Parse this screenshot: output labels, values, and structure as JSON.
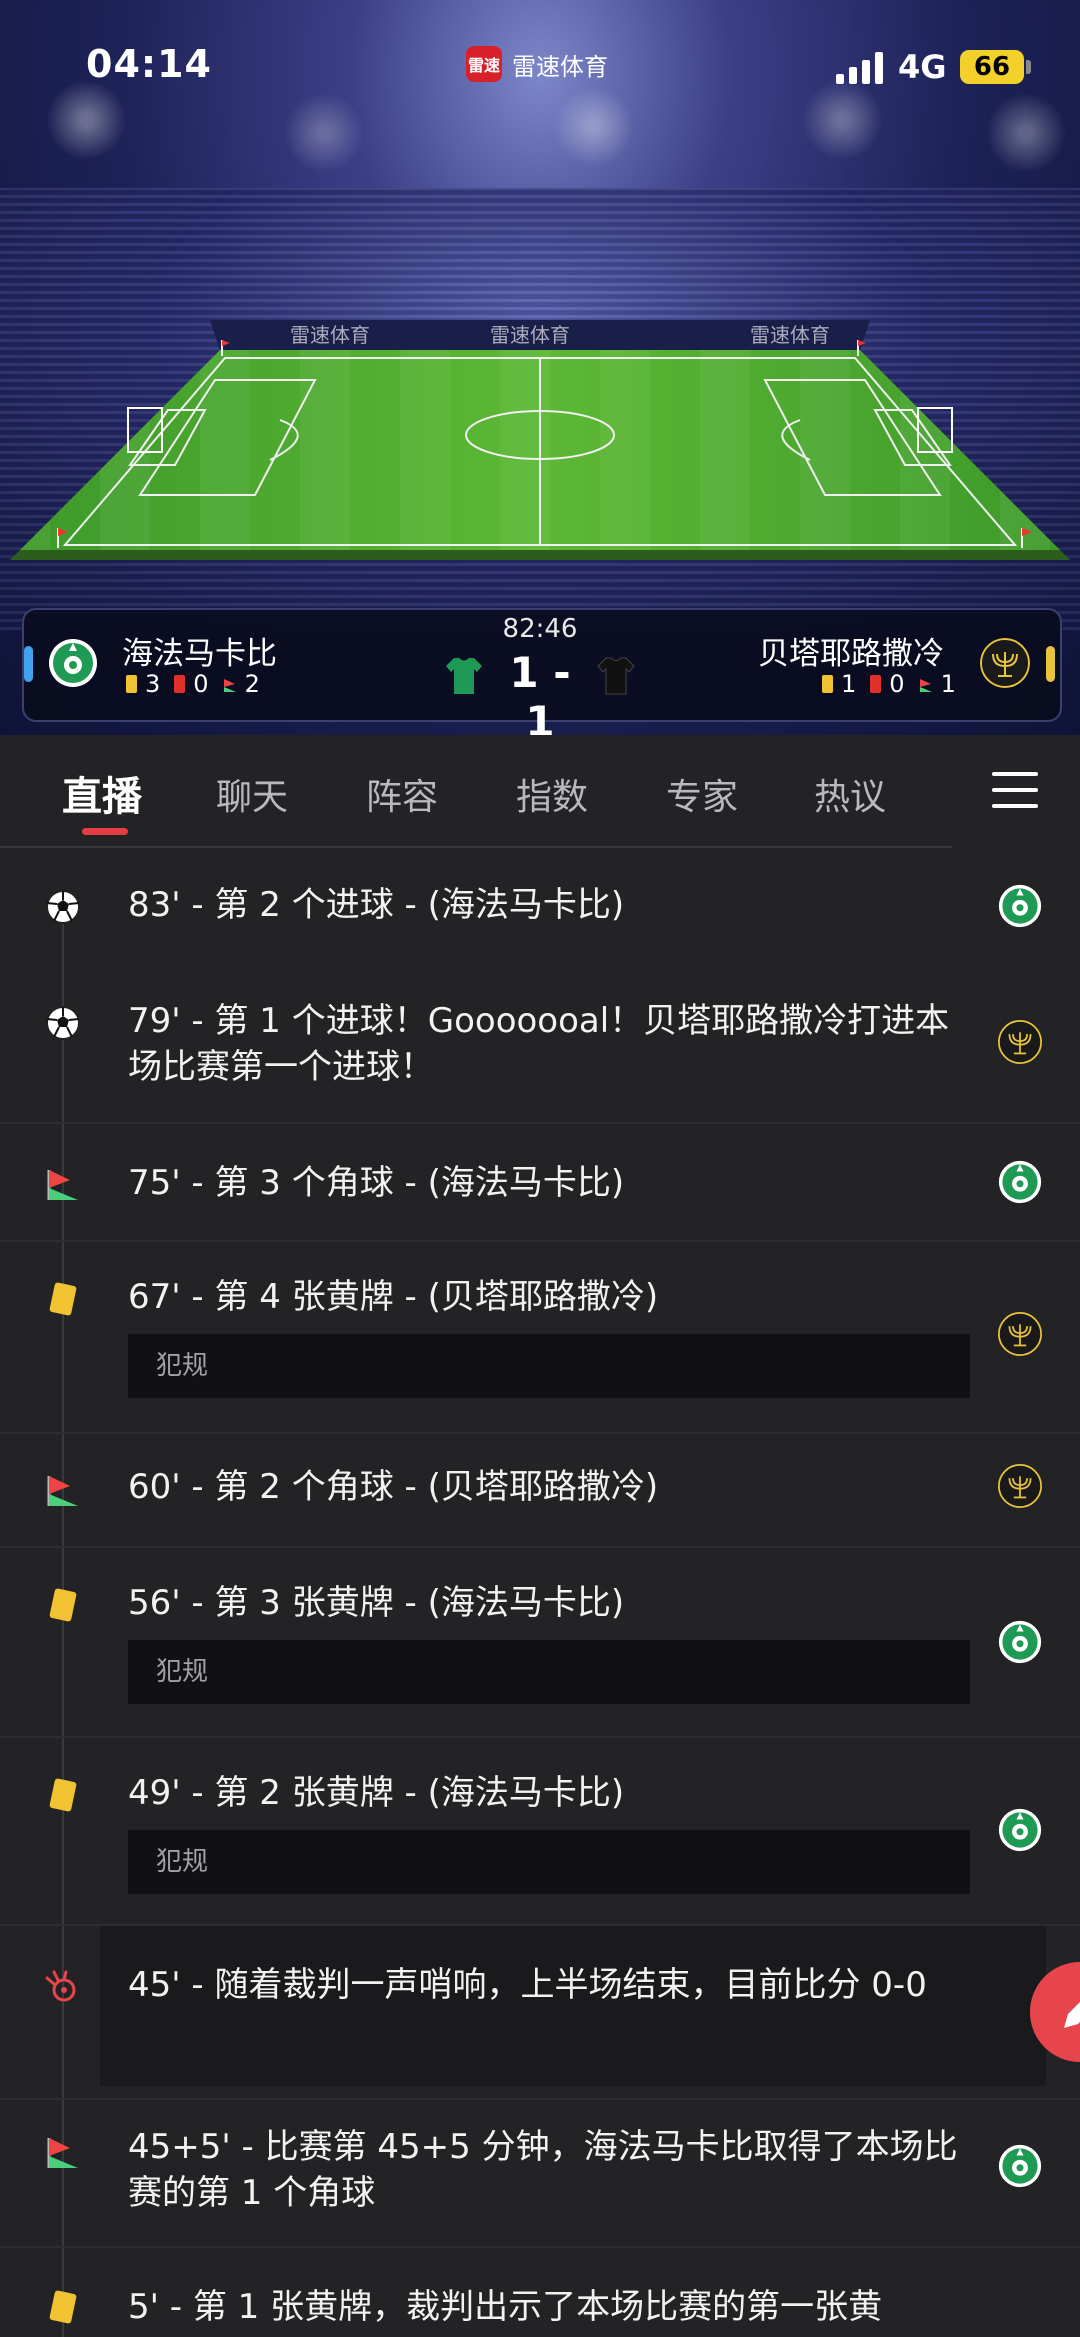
{
  "status_bar": {
    "time": "04:14",
    "app_logo_text": "雷速",
    "app_name": "雷速体育",
    "network": "4G",
    "battery": "66"
  },
  "stadium_banner": {
    "ad_text": "雷速体育"
  },
  "match": {
    "clock": "82:46",
    "score": "1 - 1",
    "home": {
      "name": "海法马卡比",
      "yellow": "3",
      "red": "0",
      "corners": "2",
      "color": "#1f9a55"
    },
    "away": {
      "name": "贝塔耶路撒冷",
      "yellow": "1",
      "red": "0",
      "corners": "1",
      "color": "#e9c33b"
    }
  },
  "tabs": [
    {
      "label": "直播",
      "active": true
    },
    {
      "label": "聊天"
    },
    {
      "label": "阵容"
    },
    {
      "label": "指数"
    },
    {
      "label": "专家"
    },
    {
      "label": "热议"
    }
  ],
  "events": [
    {
      "icon": "soccer-ball-icon",
      "text": "83' - 第 2 个进球 - (海法马卡比)",
      "team": "home"
    },
    {
      "icon": "soccer-ball-icon",
      "text": "79' - 第 1 个进球！Gooooooal！贝塔耶路撒冷打进本场比赛第一个进球！",
      "team": "away"
    },
    {
      "icon": "corner-flag-icon",
      "text": "75' - 第 3 个角球 - (海法马卡比)",
      "team": "home"
    },
    {
      "icon": "yellow-card-icon",
      "text": "67' - 第 4 张黄牌 - (贝塔耶路撒冷)",
      "detail": "犯规",
      "team": "away"
    },
    {
      "icon": "corner-flag-icon",
      "text": "60' - 第 2 个角球 - (贝塔耶路撒冷)",
      "team": "away"
    },
    {
      "icon": "yellow-card-icon",
      "text": "56' - 第 3 张黄牌 - (海法马卡比)",
      "detail": "犯规",
      "team": "home"
    },
    {
      "icon": "yellow-card-icon",
      "text": "49' - 第 2 张黄牌 - (海法马卡比)",
      "detail": "犯规",
      "team": "home"
    },
    {
      "icon": "whistle-icon",
      "text": "45' - 随着裁判一声哨响，上半场结束，目前比分 0-0",
      "team": ""
    },
    {
      "icon": "corner-flag-icon",
      "text": "45+5' - 比赛第 45+5 分钟，海法马卡比取得了本场比赛的第 1 个角球",
      "team": "home"
    },
    {
      "icon": "yellow-card-icon",
      "text": "5' - 第 1 张黄牌，裁判出示了本场比赛的第一张黄",
      "team": ""
    }
  ],
  "colors": {
    "accent": "#e43d43",
    "background": "#232325",
    "yellow_card": "#f1c232",
    "red_card": "#e0302a"
  }
}
